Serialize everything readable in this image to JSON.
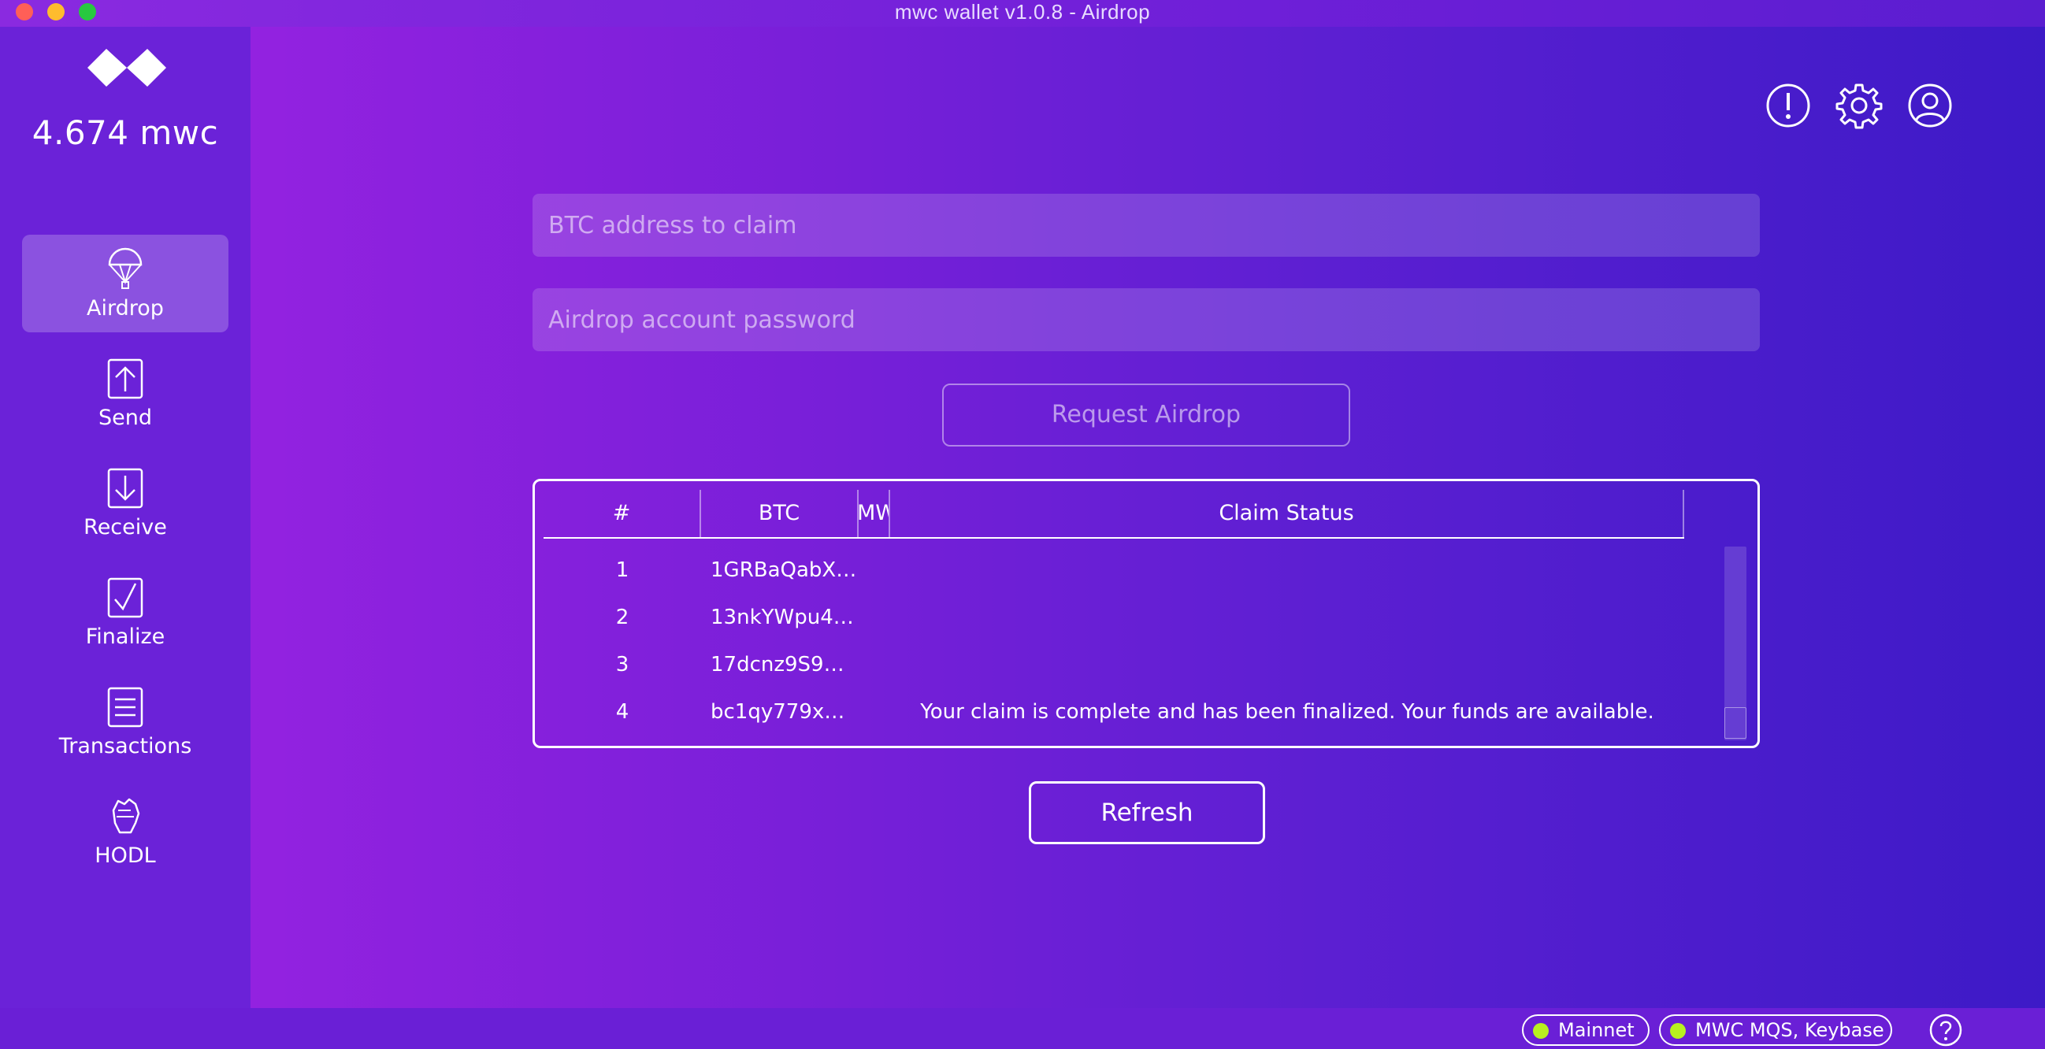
{
  "window": {
    "title": "mwc wallet v1.0.8 - Airdrop"
  },
  "sidebar": {
    "balance": "4.674 mwc",
    "items": [
      {
        "label": "Airdrop",
        "icon": "parachute-icon",
        "active": true
      },
      {
        "label": "Send",
        "icon": "upload-arrow-icon"
      },
      {
        "label": "Receive",
        "icon": "download-arrow-icon"
      },
      {
        "label": "Finalize",
        "icon": "checkbox-icon"
      },
      {
        "label": "Transactions",
        "icon": "list-icon"
      },
      {
        "label": "HODL",
        "icon": "fist-icon"
      }
    ]
  },
  "header": {
    "icons": [
      "alert-icon",
      "gear-icon",
      "account-icon"
    ]
  },
  "form": {
    "btc_placeholder": "BTC address to claim",
    "btc_value": "",
    "password_placeholder": "Airdrop account password",
    "password_value": "",
    "request_label": "Request Airdrop"
  },
  "table": {
    "columns": [
      "#",
      "BTC",
      "MWC",
      "Claim Status"
    ],
    "rows": [
      {
        "num": "1",
        "btc": "1GRBaQabX…",
        "mwc": "",
        "status": ""
      },
      {
        "num": "2",
        "btc": "13nkYWpu4…",
        "mwc": "",
        "status": ""
      },
      {
        "num": "3",
        "btc": "17dcnz9S9…",
        "mwc": "",
        "status": ""
      },
      {
        "num": "4",
        "btc": "bc1qy779x…",
        "mwc": "",
        "status": "Your claim is complete and has been finalized. Your funds are available."
      }
    ]
  },
  "refresh_label": "Refresh",
  "statusbar": {
    "network": "Mainnet",
    "listeners": "MWC MQS, Keybase",
    "indicator_color": "#b8f020"
  },
  "colors": {
    "accent": "#6b22d8",
    "gradient_start": "#9322e0",
    "gradient_end": "#3d1ac7"
  }
}
